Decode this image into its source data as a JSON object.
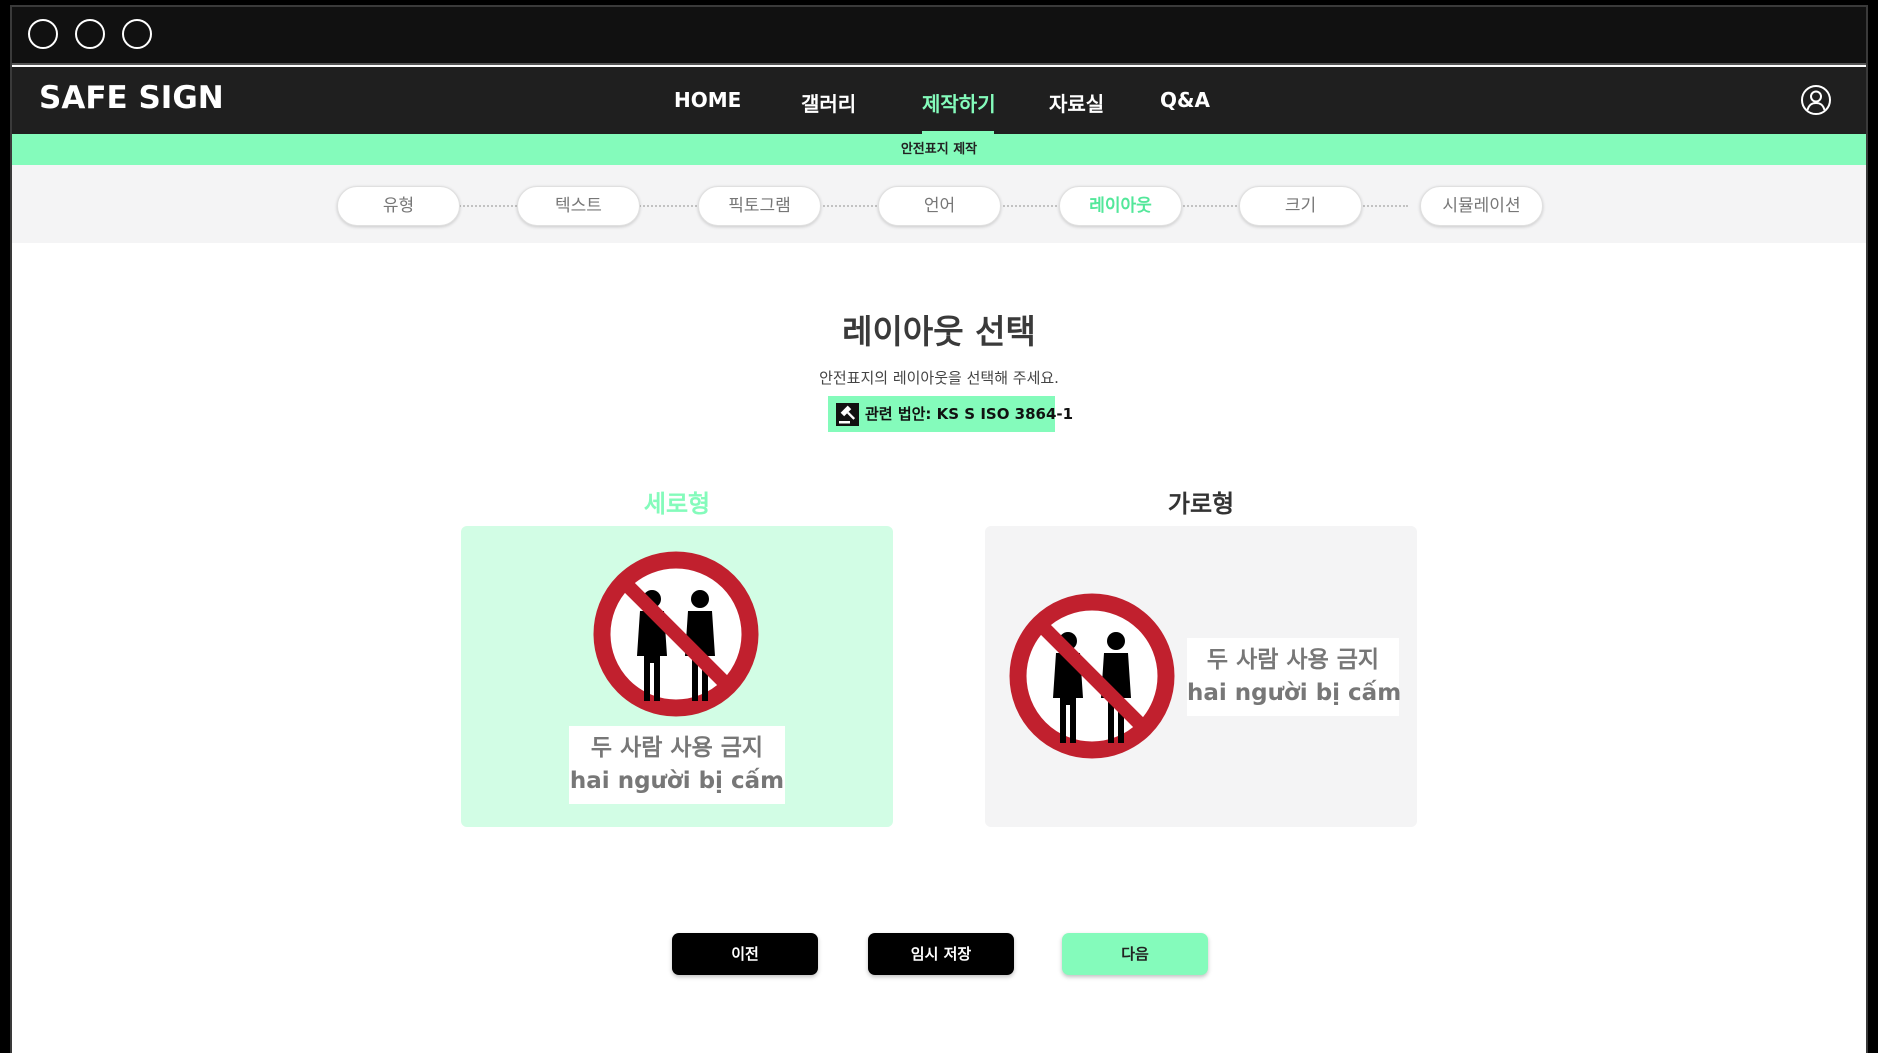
{
  "app": {
    "logo": "SAFE SIGN",
    "nav": [
      "HOME",
      "갤러리",
      "제작하기",
      "자료실",
      "Q&A"
    ],
    "active_nav": "제작하기",
    "icons": {
      "window_controls": "circle-icon",
      "user": "user-circle-icon",
      "law": "gavel-icon",
      "sign": "no-two-people-prohibition-icon"
    }
  },
  "subbar": {
    "label": "안전표지 제작"
  },
  "steps": {
    "items": [
      "유형",
      "텍스트",
      "픽토그램",
      "언어",
      "레이아웃",
      "크기",
      "시뮬레이션"
    ],
    "active": "레이아웃"
  },
  "main": {
    "title": "레이아웃 선택",
    "description": "안전표지의 레이아웃을 선택해 주세요.",
    "law_badge": "관련 법안: KS S ISO 3864-1"
  },
  "options": {
    "vertical": {
      "label": "세로형",
      "selected": true,
      "line1": "두 사람 사용 금지",
      "line2": "hai người bị cấm"
    },
    "horizontal": {
      "label": "가로형",
      "selected": false,
      "line1": "두 사람 사용 금지",
      "line2": "hai người bị cấm"
    }
  },
  "buttons": {
    "prev": "이전",
    "save": "임시 저장",
    "next": "다음"
  },
  "colors": {
    "accent": "#84fbbb",
    "selected_card": "#d2fde5",
    "card": "#f4f4f5",
    "prohibition_red": "#c1202e"
  }
}
